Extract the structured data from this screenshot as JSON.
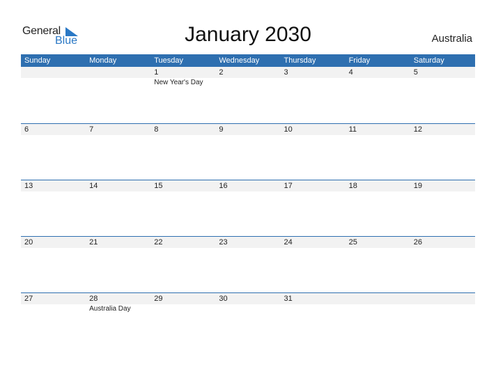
{
  "logo": {
    "line1": "General",
    "line2": "Blue"
  },
  "title": "January 2030",
  "country": "Australia",
  "colors": {
    "header_bg": "#2e6fb0",
    "date_strip_bg": "#f2f2f2",
    "logo_blue": "#2a78c5"
  },
  "weekdays": [
    "Sunday",
    "Monday",
    "Tuesday",
    "Wednesday",
    "Thursday",
    "Friday",
    "Saturday"
  ],
  "weeks": [
    {
      "days": [
        "",
        "",
        "1",
        "2",
        "3",
        "4",
        "5"
      ],
      "events": [
        "",
        "",
        "New Year's Day",
        "",
        "",
        "",
        ""
      ]
    },
    {
      "days": [
        "6",
        "7",
        "8",
        "9",
        "10",
        "11",
        "12"
      ],
      "events": [
        "",
        "",
        "",
        "",
        "",
        "",
        ""
      ]
    },
    {
      "days": [
        "13",
        "14",
        "15",
        "16",
        "17",
        "18",
        "19"
      ],
      "events": [
        "",
        "",
        "",
        "",
        "",
        "",
        ""
      ]
    },
    {
      "days": [
        "20",
        "21",
        "22",
        "23",
        "24",
        "25",
        "26"
      ],
      "events": [
        "",
        "",
        "",
        "",
        "",
        "",
        ""
      ]
    },
    {
      "days": [
        "27",
        "28",
        "29",
        "30",
        "31",
        "",
        ""
      ],
      "events": [
        "",
        "Australia Day",
        "",
        "",
        "",
        "",
        ""
      ]
    }
  ]
}
